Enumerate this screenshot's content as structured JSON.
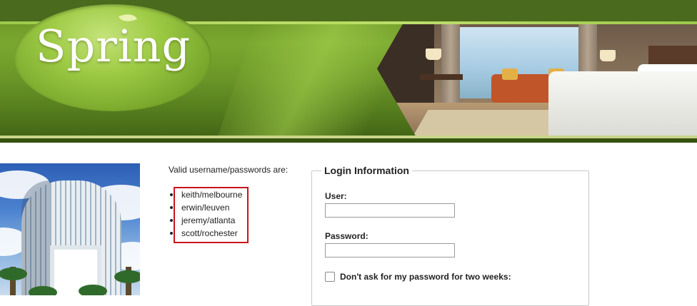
{
  "header": {
    "logo_text": "Spring"
  },
  "main": {
    "valid_title": "Valid username/passwords are:",
    "users": [
      "keith/melbourne",
      "erwin/leuven",
      "jeremy/atlanta",
      "scott/rochester"
    ]
  },
  "login": {
    "legend": "Login Information",
    "user_label": "User:",
    "user_value": "",
    "password_label": "Password:",
    "password_value": "",
    "remember_label": "Don't ask for my password for two weeks:",
    "remember_checked": false
  },
  "colors": {
    "header_green": "#6b9628",
    "highlight_red": "#c8151b"
  }
}
